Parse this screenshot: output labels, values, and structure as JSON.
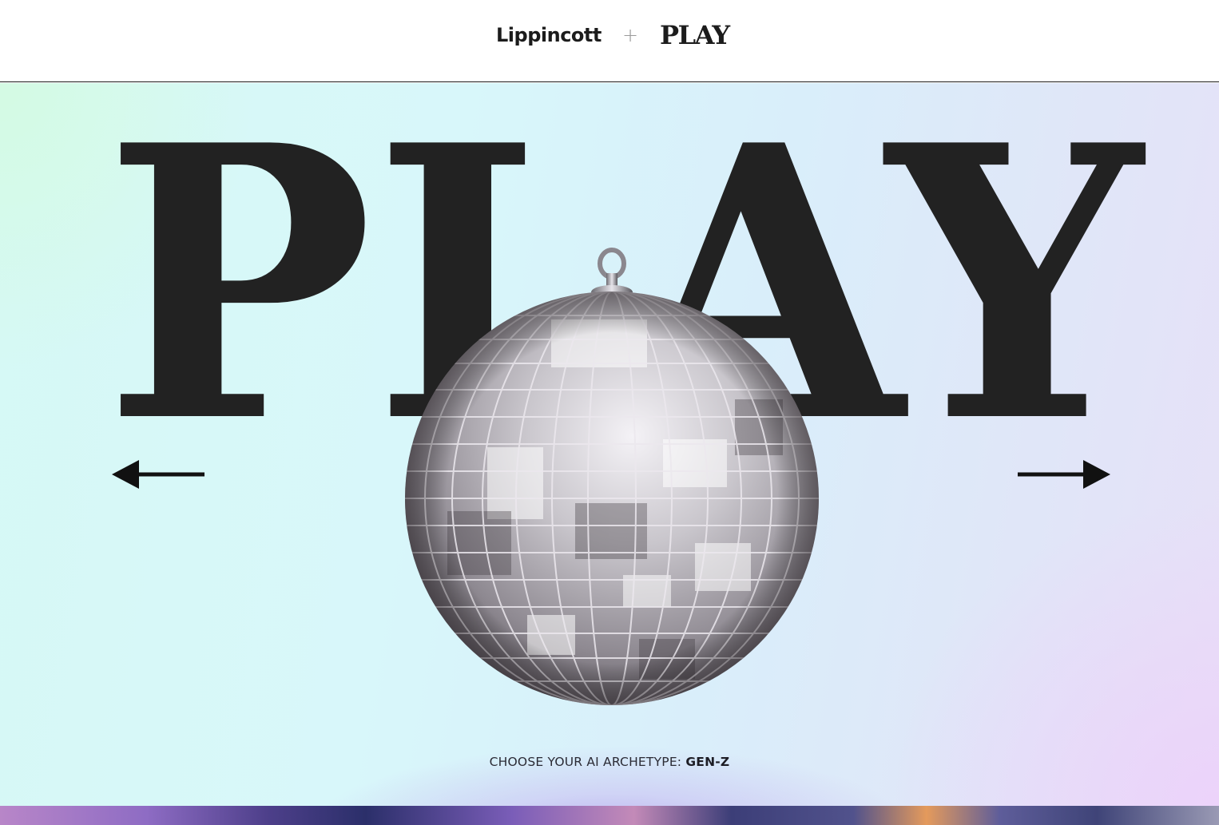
{
  "header": {
    "brand_primary": "Lippincott",
    "separator": "+",
    "brand_secondary": "PLAY"
  },
  "hero": {
    "title": "PLAY",
    "prev_arrow_icon": "arrow-left-icon",
    "next_arrow_icon": "arrow-right-icon",
    "object_icon": "disco-ball-icon",
    "archetype_prefix": "CHOOSE YOUR AI ARCHETYPE:",
    "archetype_value": "GEN-Z"
  },
  "colors": {
    "text_dark": "#222222",
    "accent_glow": "#b096ec",
    "bg_cyan": "#d8f7fa",
    "bg_lavender": "#e7e0f7"
  }
}
